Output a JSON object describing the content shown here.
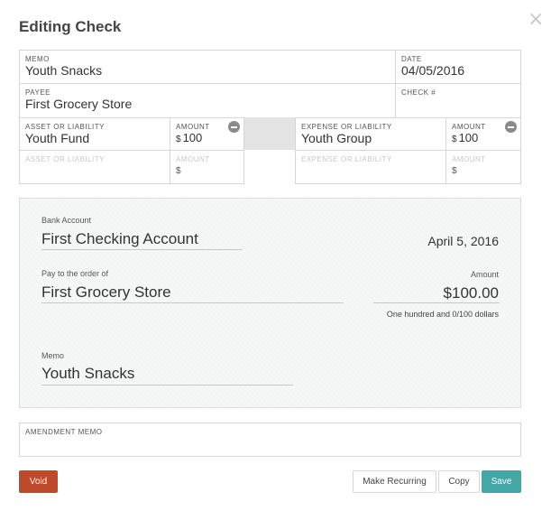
{
  "dialog": {
    "title": "Editing Check",
    "close_icon": "close-icon"
  },
  "form": {
    "memo": {
      "label": "MEMO",
      "value": "Youth Snacks"
    },
    "date": {
      "label": "DATE",
      "value": "04/05/2016"
    },
    "payee": {
      "label": "PAYEE",
      "value": "First Grocery Store"
    },
    "check_number": {
      "label": "CHECK #",
      "value": ""
    },
    "asset_rows": [
      {
        "label": "ASSET OR LIABILITY",
        "value": "Youth Fund",
        "amount_label": "AMOUNT",
        "currency": "$",
        "amount": "100"
      },
      {
        "label": "ASSET OR LIABILITY",
        "value": "",
        "amount_label": "AMOUNT",
        "currency": "$",
        "amount": ""
      }
    ],
    "expense_rows": [
      {
        "label": "EXPENSE OR LIABILITY",
        "value": "Youth Group",
        "amount_label": "AMOUNT",
        "currency": "$",
        "amount": "100"
      },
      {
        "label": "EXPENSE OR LIABILITY",
        "value": "",
        "amount_label": "AMOUNT",
        "currency": "$",
        "amount": ""
      }
    ]
  },
  "check_preview": {
    "bank_account_label": "Bank Account",
    "bank_account": "First Checking Account",
    "date": "April 5, 2016",
    "pay_to_label": "Pay to the order of",
    "pay_to": "First Grocery Store",
    "amount_label": "Amount",
    "amount": "$100.00",
    "amount_words": "One hundred and 0/100 dollars",
    "memo_label": "Memo",
    "memo": "Youth Snacks"
  },
  "amendment_memo": {
    "label": "AMENDMENT MEMO",
    "value": ""
  },
  "buttons": {
    "void": "Void",
    "make_recurring": "Make Recurring",
    "copy": "Copy",
    "save": "Save"
  },
  "colors": {
    "void": "#bf4a2b",
    "save": "#43a7a6"
  }
}
